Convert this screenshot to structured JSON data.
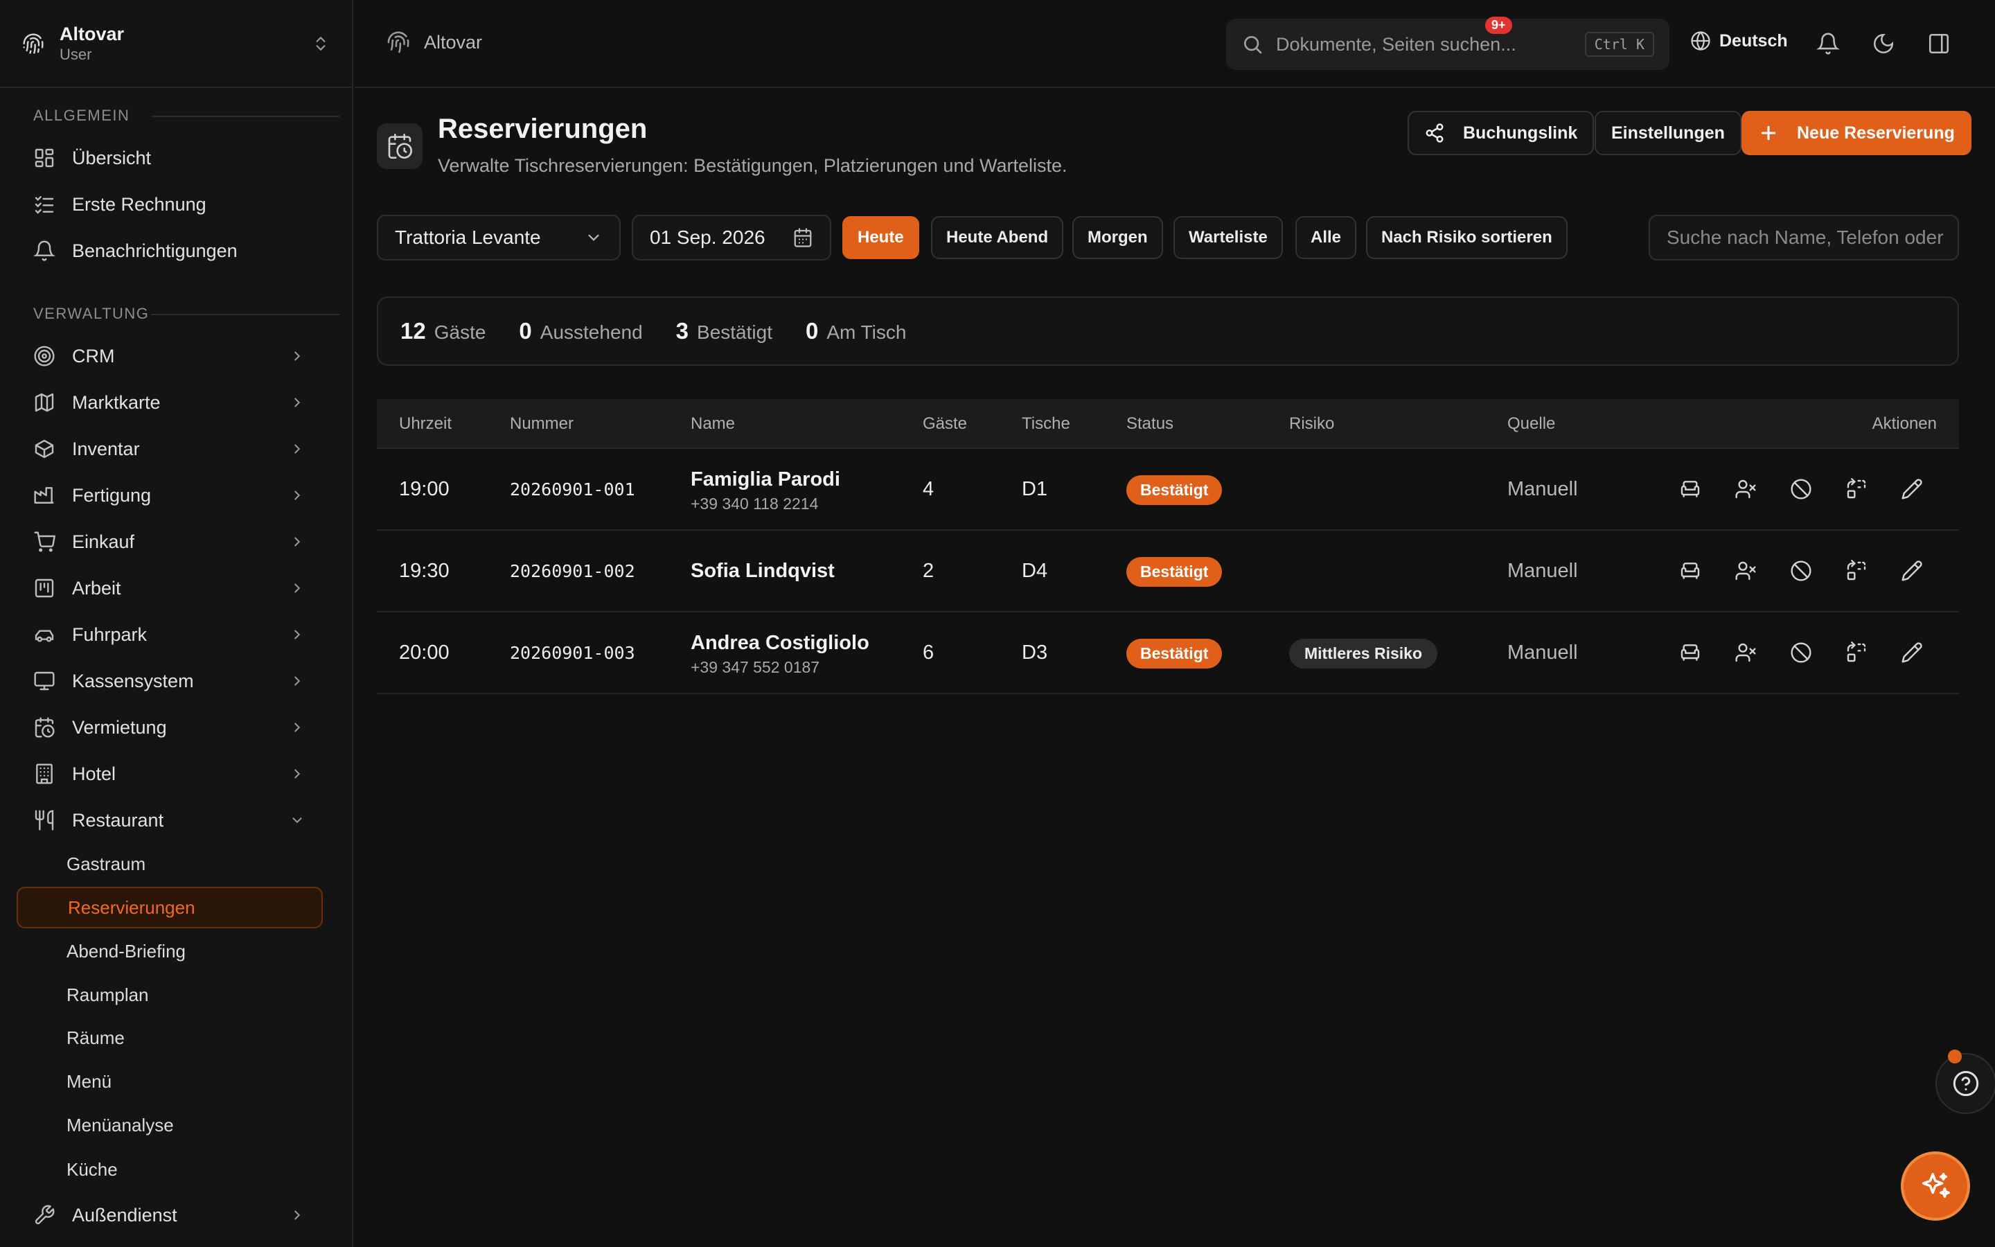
{
  "brand": {
    "name": "Altovar",
    "role": "User"
  },
  "sidebar": {
    "section_general": "ALLGEMEIN",
    "general_items": [
      {
        "label": "Übersicht",
        "icon": "dashboard-icon"
      },
      {
        "label": "Erste Rechnung",
        "icon": "checklist-icon"
      },
      {
        "label": "Benachrichtigungen",
        "icon": "bell-icon"
      }
    ],
    "section_admin": "VERWALTUNG",
    "admin_items": [
      {
        "label": "CRM",
        "icon": "target-icon"
      },
      {
        "label": "Marktkarte",
        "icon": "map-icon"
      },
      {
        "label": "Inventar",
        "icon": "box-icon"
      },
      {
        "label": "Fertigung",
        "icon": "factory-icon"
      },
      {
        "label": "Einkauf",
        "icon": "cart-icon"
      },
      {
        "label": "Arbeit",
        "icon": "kanban-icon"
      },
      {
        "label": "Fuhrpark",
        "icon": "car-icon"
      },
      {
        "label": "Kassensystem",
        "icon": "monitor-icon"
      },
      {
        "label": "Vermietung",
        "icon": "calendar-clock-icon"
      },
      {
        "label": "Hotel",
        "icon": "building-icon"
      },
      {
        "label": "Restaurant",
        "icon": "utensils-icon"
      }
    ],
    "restaurant_sub": [
      "Gastraum",
      "Reservierungen",
      "Abend-Briefing",
      "Raumplan",
      "Räume",
      "Menü",
      "Menüanalyse",
      "Küche"
    ],
    "last_item": {
      "label": "Außendienst",
      "icon": "wrench-icon"
    }
  },
  "topbar": {
    "breadcrumb": "Altovar",
    "search_placeholder": "Dokumente, Seiten suchen...",
    "shortcut": "Ctrl K",
    "language": "Deutsch",
    "notif_count": "9+"
  },
  "page": {
    "title": "Reservierungen",
    "subtitle": "Verwalte Tischreservierungen: Bestätigungen, Platzierungen und Warteliste.",
    "btn_booking_link": "Buchungslink",
    "btn_settings": "Einstellungen",
    "btn_new": "Neue Reservierung"
  },
  "filters": {
    "restaurant": "Trattoria Levante",
    "date": "01 Sep. 2026",
    "chips": [
      "Heute",
      "Heute Abend",
      "Morgen",
      "Warteliste",
      "Alle",
      "Nach Risiko sortieren"
    ],
    "active_chip": "Heute",
    "search_placeholder": "Suche nach Name, Telefon oder"
  },
  "stats": [
    {
      "value": "12",
      "label": "Gäste"
    },
    {
      "value": "0",
      "label": "Ausstehend"
    },
    {
      "value": "3",
      "label": "Bestätigt"
    },
    {
      "value": "0",
      "label": "Am Tisch"
    }
  ],
  "table": {
    "headers": [
      "Uhrzeit",
      "Nummer",
      "Name",
      "Gäste",
      "Tische",
      "Status",
      "Risiko",
      "Quelle",
      "Aktionen"
    ],
    "rows": [
      {
        "time": "19:00",
        "number": "20260901-001",
        "name": "Famiglia Parodi",
        "phone": "+39 340 118 2214",
        "guests": "4",
        "table": "D1",
        "status": "Bestätigt",
        "risk": "",
        "source": "Manuell"
      },
      {
        "time": "19:30",
        "number": "20260901-002",
        "name": "Sofia Lindqvist",
        "phone": "",
        "guests": "2",
        "table": "D4",
        "status": "Bestätigt",
        "risk": "",
        "source": "Manuell"
      },
      {
        "time": "20:00",
        "number": "20260901-003",
        "name": "Andrea Costigliolo",
        "phone": "+39 347 552 0187",
        "guests": "6",
        "table": "D3",
        "status": "Bestätigt",
        "risk": "Mittleres Risiko",
        "source": "Manuell"
      }
    ]
  },
  "colors": {
    "accent": "#e0601a",
    "background": "#111111",
    "sidebar": "#141414"
  }
}
